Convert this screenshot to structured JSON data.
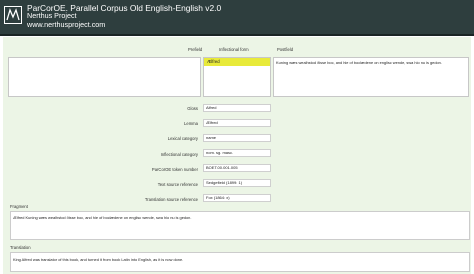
{
  "header": {
    "title": "ParCorOE. Parallel Corpus Old English-English v2.0",
    "project": "Nerthus Project",
    "url": "www.nerthusproject.com",
    "logo_icon": "nerthus-logo-icon"
  },
  "columns": {
    "prefield": "Prefield",
    "inflectional_form": "Inflectional form",
    "postfield": "Postfield"
  },
  "concordance": {
    "prefield": "",
    "inflectional_form": "Ælfred",
    "postfield": "Kuning wæs wealhstod ðisse boc, and hie of boclædene on englisc wende, swa hio nu is gedon."
  },
  "fields": [
    {
      "key": "gloss",
      "label": "Gloss",
      "value": "Alfred"
    },
    {
      "key": "lemma",
      "label": "Lemma",
      "value": "Ælfred"
    },
    {
      "key": "lexical_category",
      "label": "Lexical category",
      "value": "name"
    },
    {
      "key": "inflectional_category",
      "label": "Inflectional category",
      "value": "nom. sg. masc."
    },
    {
      "key": "token_number",
      "label": "ParCorOE token number",
      "value": "BOET.00.001.005"
    },
    {
      "key": "text_source",
      "label": "Text source reference",
      "value": "Sedgefield (1899: 1)"
    },
    {
      "key": "translation_source",
      "label": "Translation source reference",
      "value": "Fox (1864: x)"
    }
  ],
  "fragment": {
    "label": "Fragment",
    "text": "Ælfred Kuning wæs wealhstod ðisse boc, and hie of boclædene on englisc wende, swa hio nu is gedon."
  },
  "translation": {
    "label": "Translation",
    "text": "King Alfred was translator of this book, and turned it from book Latin into English, as it is now done."
  },
  "colors": {
    "header_bg": "#2e3e3e",
    "panel_bg": "#ecf5e6",
    "highlight": "#e8ea3a"
  }
}
